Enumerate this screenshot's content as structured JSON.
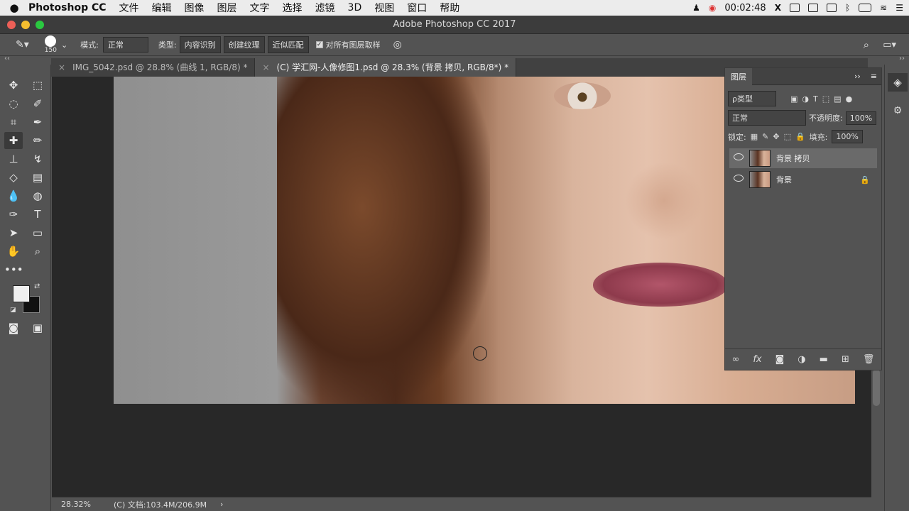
{
  "menubar": {
    "apple": "",
    "app": "Photoshop CC",
    "items": [
      "文件",
      "编辑",
      "图像",
      "图层",
      "文字",
      "选择",
      "滤镜",
      "3D",
      "视图",
      "窗口",
      "帮助"
    ],
    "clock": "00:02:48"
  },
  "window": {
    "title": "Adobe Photoshop CC 2017",
    "traffic": [
      "#ec5f57",
      "#f5bd2f",
      "#2ac840"
    ]
  },
  "options": {
    "brush_size": "150",
    "mode_label": "模式:",
    "mode_value": "正常",
    "type_label": "类型:",
    "type_buttons": [
      "内容识别",
      "创建纹理",
      "近似匹配"
    ],
    "sample_all": "对所有图层取样"
  },
  "tabs": [
    {
      "label": "IMG_5042.psd @ 28.8% (曲线 1, RGB/8) *",
      "active": false
    },
    {
      "label": "(C) 学汇网-人像修图1.psd @ 28.3% (背景 拷贝, RGB/8*) *",
      "active": true
    }
  ],
  "status": {
    "zoom": "28.32%",
    "doc": "(C) 文档:103.4M/206.9M",
    "arrow": "›"
  },
  "layers_panel": {
    "title": "图层",
    "kind_filter": "ρ类型",
    "blend_mode": "正常",
    "opacity_label": "不透明度:",
    "opacity_value": "100%",
    "lock_label": "锁定:",
    "fill_label": "填充:",
    "fill_value": "100%",
    "layers": [
      {
        "name": "背景 拷贝",
        "selected": true,
        "locked": false
      },
      {
        "name": "背景",
        "selected": false,
        "locked": true
      }
    ],
    "footer_icons": [
      "link-icon",
      "fx-icon",
      "mask-icon",
      "adjustment-icon",
      "folder-icon",
      "new-layer-icon",
      "trash-icon"
    ],
    "fx": "fx"
  },
  "tools": {
    "more": "•••"
  },
  "colors": {
    "foreground": "#f0f0f0",
    "background": "#111111",
    "accent": "#3a3a3a"
  }
}
